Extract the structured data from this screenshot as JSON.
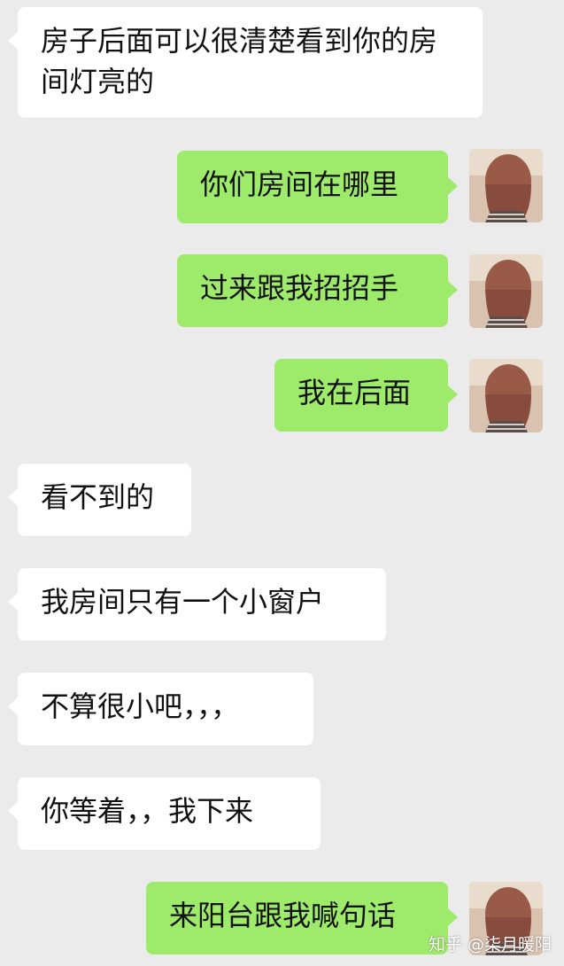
{
  "messages": [
    {
      "side": "in",
      "text": "房子后面可以很清楚看到你的房间灯亮的"
    },
    {
      "side": "out",
      "text": "你们房间在哪里"
    },
    {
      "side": "out",
      "text": "过来跟我招招手"
    },
    {
      "side": "out",
      "text": "我在后面"
    },
    {
      "side": "in",
      "text": "看不到的"
    },
    {
      "side": "in",
      "text": "我房间只有一个小窗户"
    },
    {
      "side": "in",
      "text": "不算很小吧，，，"
    },
    {
      "side": "in",
      "text": "你等着，，我下来"
    },
    {
      "side": "out",
      "text": "来阳台跟我喊句话"
    }
  ],
  "watermark": "知乎 @柒月暖阳",
  "colors": {
    "background": "#ebebeb",
    "incoming_bubble": "#ffffff",
    "outgoing_bubble": "#9eea6a"
  },
  "avatar": {
    "icon": "user-avatar-icon"
  }
}
